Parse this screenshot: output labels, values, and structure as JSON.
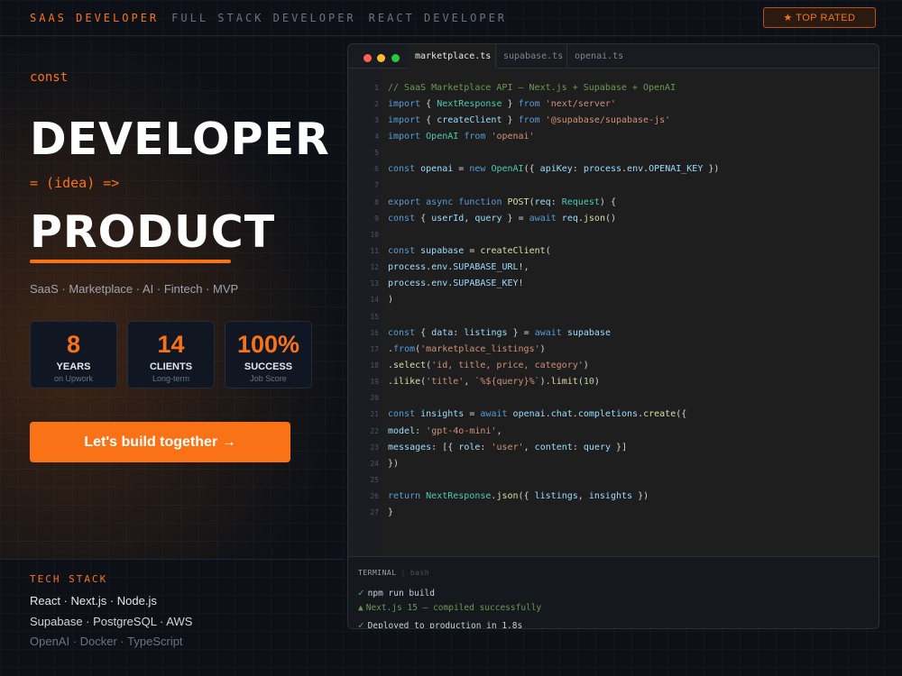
{
  "topbar": {
    "roles": [
      "SAAS DEVELOPER",
      "FULL STACK DEVELOPER",
      "REACT DEVELOPER"
    ],
    "badge": "★ TOP RATED"
  },
  "hero": {
    "const": "const",
    "line1": "DEVELOPER",
    "arrow": "= (idea) =>",
    "line2": "PRODUCT",
    "tags": "SaaS · Marketplace · AI · Fintech · MVP"
  },
  "stats": [
    {
      "num": "8",
      "label": "YEARS",
      "sub": "on Upwork"
    },
    {
      "num": "14",
      "label": "CLIENTS",
      "sub": "Long-term"
    },
    {
      "num": "100%",
      "label": "SUCCESS",
      "sub": "Job Score"
    }
  ],
  "cta": "Let's build together →",
  "stack": {
    "title": "TECH STACK",
    "line1": "React · Next.js · Node.js",
    "line2": "Supabase · PostgreSQL · AWS",
    "line3": "OpenAI · Docker · TypeScript"
  },
  "editor": {
    "tabs": [
      "marketplace.ts",
      "supabase.ts",
      "openai.ts"
    ],
    "lines": [
      "// SaaS Marketplace API — Next.js + Supabase + OpenAI",
      "import { NextResponse } from 'next/server'",
      "import { createClient } from '@supabase/supabase-js'",
      "import OpenAI from 'openai'",
      "",
      "const openai = new OpenAI({ apiKey: process.env.OPENAI_KEY })",
      "",
      "export async function POST(req: Request) {",
      "const { userId, query } = await req.json()",
      "",
      "const supabase = createClient(",
      "process.env.SUPABASE_URL!,",
      "process.env.SUPABASE_KEY!",
      ")",
      "",
      "const { data: listings } = await supabase",
      ".from('marketplace_listings')",
      ".select('id, title, price, category')",
      ".ilike('title', `%${query}%`).limit(10)",
      "",
      "const insights = await openai.chat.completions.create({",
      "model: 'gpt-4o-mini',",
      "messages: [{ role: 'user', content: query }]",
      "})",
      "",
      "return NextResponse.json({ listings, insights })",
      "}"
    ]
  },
  "terminal": {
    "label": "TERMINAL",
    "shell": "bash",
    "line1": "npm run build",
    "line2": "Next.js 15 — compiled successfully",
    "line3": "Deployed to production in 1.8s"
  }
}
